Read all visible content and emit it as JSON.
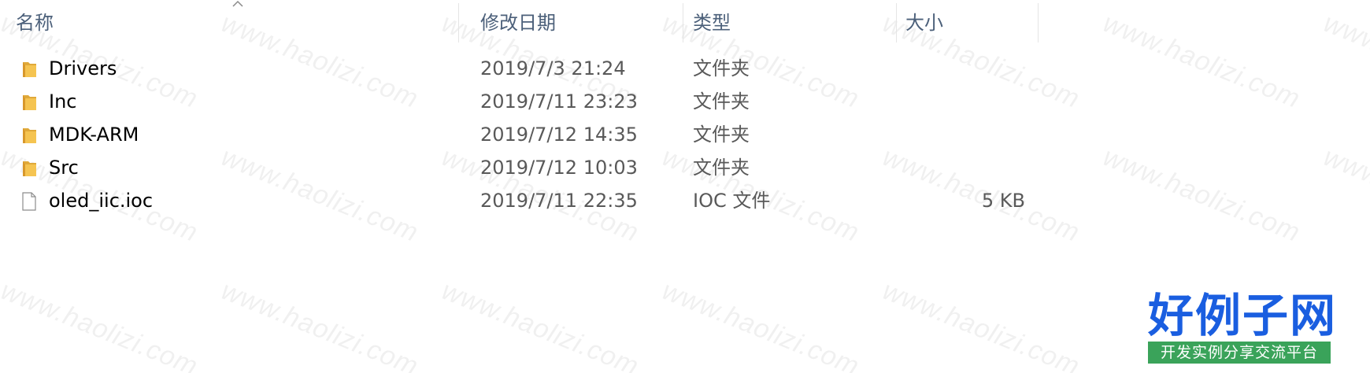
{
  "columns": {
    "name": "名称",
    "date": "修改日期",
    "type": "类型",
    "size": "大小"
  },
  "files": [
    {
      "name": "Drivers",
      "date": "2019/7/3 21:24",
      "type": "文件夹",
      "size": "",
      "icon": "folder-icon"
    },
    {
      "name": "Inc",
      "date": "2019/7/11 23:23",
      "type": "文件夹",
      "size": "",
      "icon": "folder-icon"
    },
    {
      "name": "MDK-ARM",
      "date": "2019/7/12 14:35",
      "type": "文件夹",
      "size": "",
      "icon": "folder-icon"
    },
    {
      "name": "Src",
      "date": "2019/7/12 10:03",
      "type": "文件夹",
      "size": "",
      "icon": "folder-icon"
    },
    {
      "name": "oled_iic.ioc",
      "date": "2019/7/11 22:35",
      "type": "IOC 文件",
      "size": "5 KB",
      "icon": "file-icon"
    }
  ],
  "watermark": "www.haolizi.com",
  "logo": {
    "title": "好例子网",
    "subtitle": "开发实例分享交流平台"
  },
  "colors": {
    "header_text": "#4c607a",
    "folder": "#f5c451",
    "logo_blue": "#1a5ee0",
    "logo_green": "#3aa35a"
  }
}
